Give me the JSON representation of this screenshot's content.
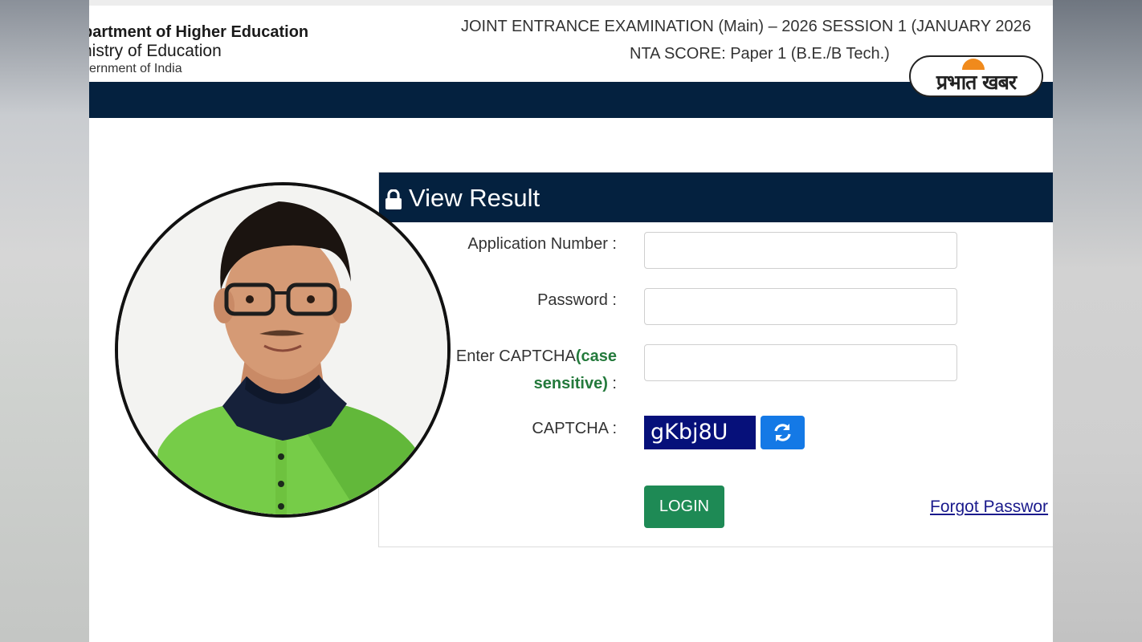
{
  "header": {
    "dept_line1": "partment of Higher Education",
    "dept_line2": "nistry of Education",
    "dept_line3": "vernment of India",
    "exam_title": "JOINT ENTRANCE EXAMINATION (Main) – 2026 SESSION 1 (JANUARY 2026",
    "exam_subtitle": "NTA SCORE: Paper 1 (B.E./B Tech.)"
  },
  "logo": {
    "text": "प्रभात खबर"
  },
  "form": {
    "title": "View Result",
    "application_label": "Application Number :",
    "application_value": "",
    "password_label": "Password :",
    "password_value": "",
    "captcha_input_label": "Enter CAPTCHA",
    "captcha_input_label_note_1": "(case",
    "captcha_input_label_note_2": "sensitive)",
    "captcha_input_label_suffix": " :",
    "captcha_input_value": "",
    "captcha_label": "CAPTCHA :",
    "captcha_code": "gKbj8U",
    "login_button": "LOGIN",
    "forgot_link": "Forgot Passwor"
  },
  "colors": {
    "navy": "#04213f",
    "login_green": "#1e8a55",
    "captcha_bg": "#06107a",
    "refresh_blue": "#1479e6"
  },
  "icons": {
    "lock": "lock-icon",
    "refresh": "refresh-icon"
  }
}
